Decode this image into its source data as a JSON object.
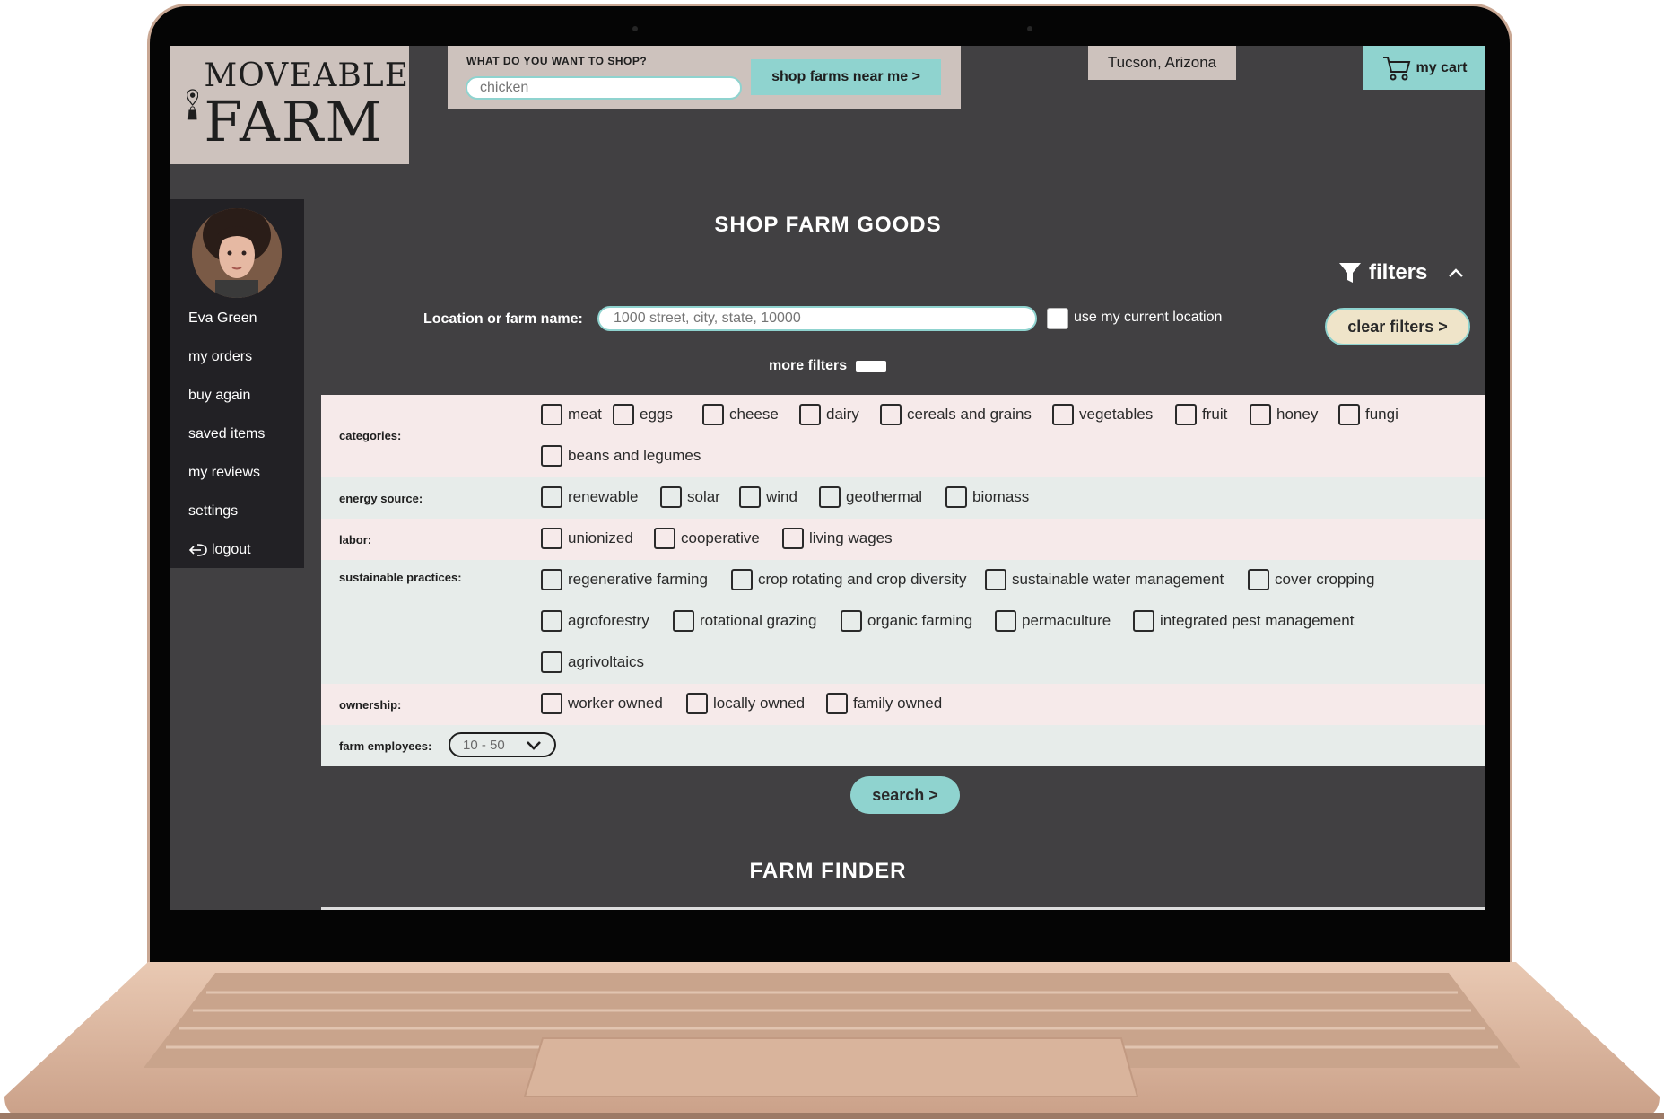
{
  "header": {
    "logo_line1": "MOVEABLE",
    "logo_line2": "FARM",
    "search_label": "WHAT DO YOU WANT TO SHOP?",
    "search_placeholder": "chicken",
    "shop_near_label": "shop farms near me >",
    "location": "Tucson, Arizona",
    "cart_label": "my cart"
  },
  "sidebar": {
    "user_name": "Eva Green",
    "items": [
      {
        "label": "my orders"
      },
      {
        "label": "buy again"
      },
      {
        "label": "saved items"
      },
      {
        "label": "my reviews"
      },
      {
        "label": "settings"
      }
    ],
    "logout_label": "logout"
  },
  "main": {
    "title": "SHOP FARM GOODS",
    "filters_label": "filters",
    "location_label": "Location or farm name:",
    "location_placeholder": "1000 street, city, state, 10000",
    "current_location_label": "use my current location",
    "clear_filters_label": "clear filters  >",
    "more_filters_label": "more filters",
    "search_label": "search  >",
    "farm_finder_title": "FARM FINDER"
  },
  "filters": {
    "categories": {
      "label": "categories:",
      "options": [
        "meat",
        "eggs",
        "cheese",
        "dairy",
        "cereals and grains",
        "vegetables",
        "fruit",
        "honey",
        "fungi",
        "beans and legumes"
      ]
    },
    "energy": {
      "label": "energy source:",
      "options": [
        "renewable",
        "solar",
        "wind",
        "geothermal",
        "biomass"
      ]
    },
    "labor": {
      "label": "labor:",
      "options": [
        "unionized",
        "cooperative",
        "living wages"
      ]
    },
    "sustainable": {
      "label": "sustainable practices:",
      "options": [
        "regenerative farming",
        "crop rotating and crop diversity",
        "sustainable water management",
        "cover cropping",
        "agroforestry",
        "rotational grazing",
        "organic farming",
        "permaculture",
        "integrated pest management",
        "agrivoltaics"
      ]
    },
    "ownership": {
      "label": "ownership:",
      "options": [
        "worker owned",
        "locally owned",
        "family owned"
      ]
    },
    "employees": {
      "label": "farm employees:",
      "value": "10 - 50"
    }
  },
  "icons": {
    "location_pin": "map-pin-icon",
    "cart": "cart-icon",
    "filter": "funnel-icon",
    "collapse": "chevron-up-icon",
    "dropdown": "chevron-down-icon",
    "logout": "logout-icon"
  },
  "colors": {
    "accent": "#8fd3cf",
    "beige": "#cdc2bd",
    "background": "#414042",
    "row_pink": "#f6eaea",
    "row_gray": "#e7ecea"
  }
}
